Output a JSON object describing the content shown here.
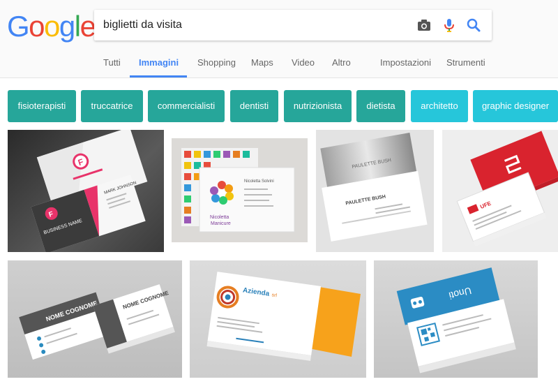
{
  "logo": {
    "letters": [
      "G",
      "o",
      "o",
      "g",
      "l",
      "e"
    ],
    "colors": [
      "#4285f4",
      "#ea4335",
      "#fbbc05",
      "#4285f4",
      "#34a853",
      "#ea4335"
    ]
  },
  "search": {
    "query": "biglietti da visita",
    "icons": [
      "camera-icon",
      "microphone-icon",
      "search-icon"
    ]
  },
  "tabs": [
    {
      "label": "Tutti"
    },
    {
      "label": "Immagini",
      "active": true
    },
    {
      "label": "Shopping"
    },
    {
      "label": "Maps"
    },
    {
      "label": "Video"
    },
    {
      "label": "Altro"
    },
    {
      "label": "Impostazioni"
    },
    {
      "label": "Strumenti"
    }
  ],
  "chips": [
    {
      "label": "fisioterapisti",
      "color": "#26a69a"
    },
    {
      "label": "truccatrice",
      "color": "#26a69a"
    },
    {
      "label": "commercialisti",
      "color": "#26a69a"
    },
    {
      "label": "dentisti",
      "color": "#26a69a"
    },
    {
      "label": "nutrizionista",
      "color": "#26a69a"
    },
    {
      "label": "dietista",
      "color": "#26a69a"
    },
    {
      "label": "architetto",
      "color": "#26c6da"
    },
    {
      "label": "graphic designer",
      "color": "#26c6da"
    }
  ],
  "cards": {
    "card1": {
      "logo_letter": "F",
      "brand_line": "BUSINESS NAME",
      "person": "MARK JOHNSON"
    },
    "card2": {
      "brand_top": "Nicoletta",
      "brand_bottom": "Manicure",
      "person": "Nicoletta Solvini"
    },
    "card3": {
      "person": "PAULETTE BUSH"
    },
    "card4": {
      "brand": "UFE"
    },
    "card5": {
      "person_front": "NOME COGNOME",
      "person_back": "NOME COGNOME"
    },
    "card6": {
      "brand": "Azienda",
      "brand_suffix": "srl"
    },
    "card7": {
      "brand": "Unoti"
    }
  }
}
